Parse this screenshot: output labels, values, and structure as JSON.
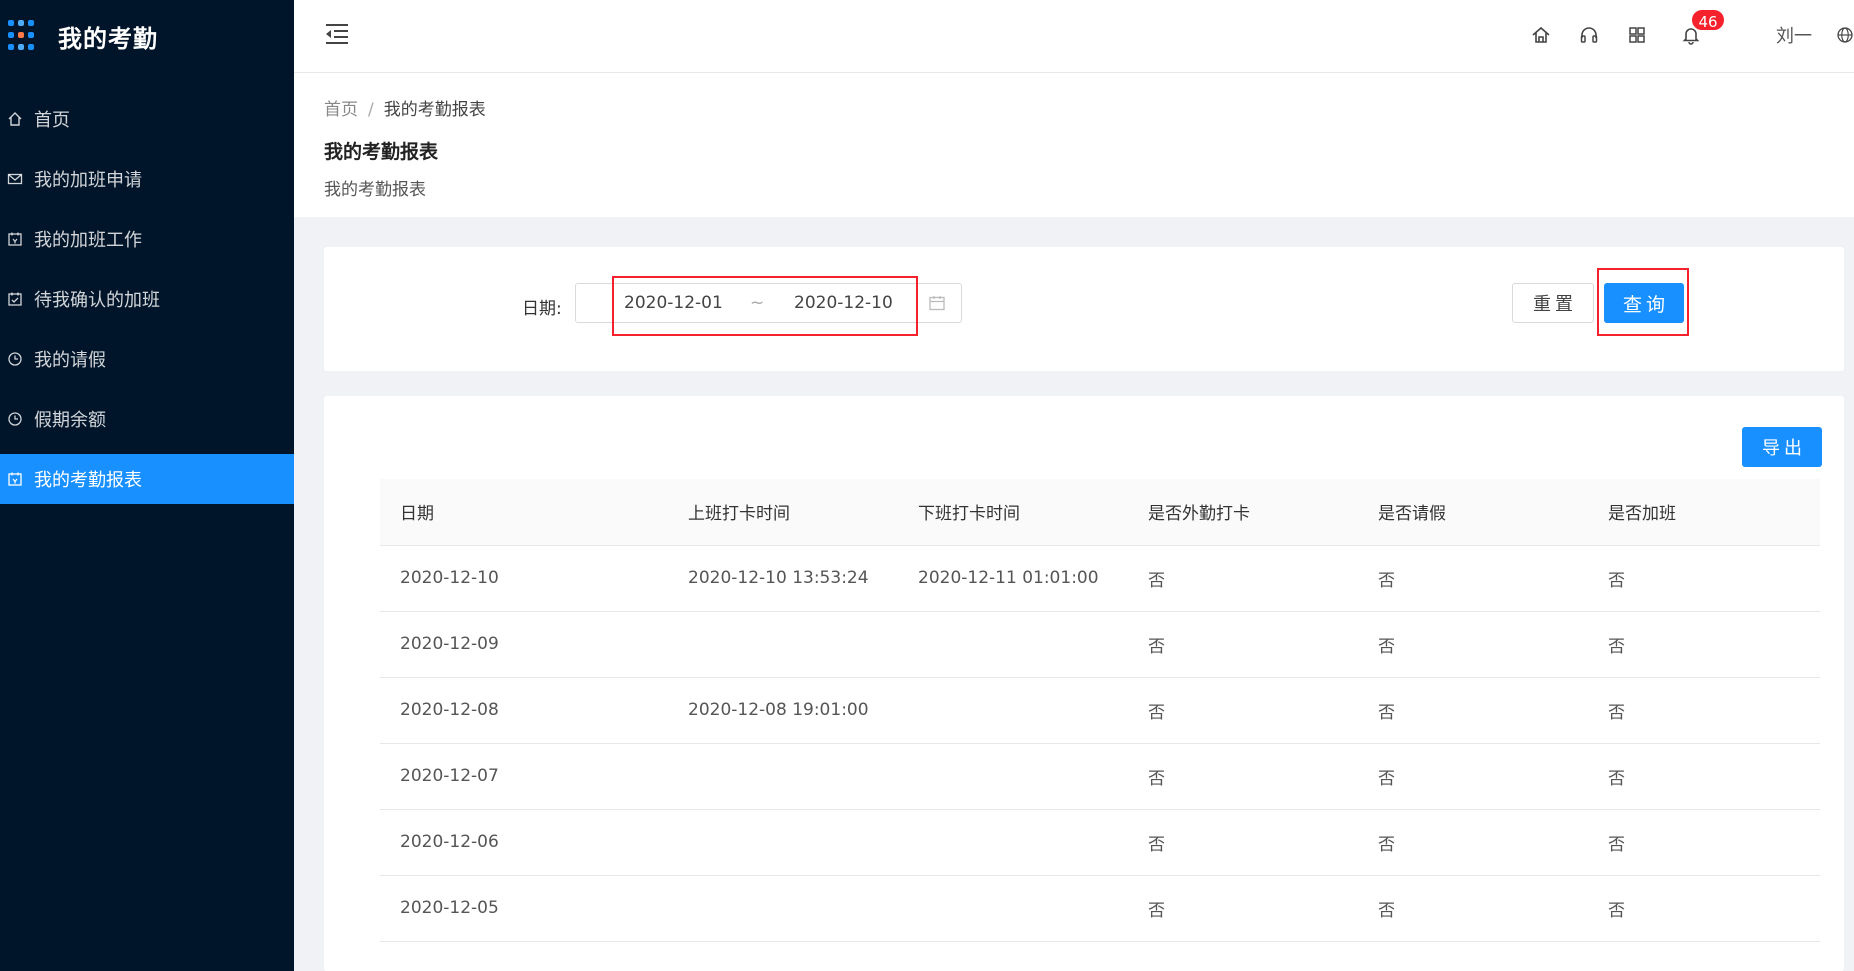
{
  "app": {
    "title": "我的考勤"
  },
  "sidebar": {
    "items": [
      {
        "label": "首页",
        "icon": "home-icon"
      },
      {
        "label": "我的加班申请",
        "icon": "mail-icon"
      },
      {
        "label": "我的加班工作",
        "icon": "calendar-icon"
      },
      {
        "label": "待我确认的加班",
        "icon": "check-icon"
      },
      {
        "label": "我的请假",
        "icon": "clock-icon"
      },
      {
        "label": "假期余额",
        "icon": "clock-icon"
      },
      {
        "label": "我的考勤报表",
        "icon": "calendar-icon",
        "active": true
      }
    ]
  },
  "header": {
    "icons": [
      "home-icon",
      "headset-icon",
      "apps-icon",
      "bell-icon",
      "globe-icon"
    ],
    "notification_count": "46",
    "username": "刘一"
  },
  "breadcrumb": {
    "home": "首页",
    "separator": "/",
    "current": "我的考勤报表"
  },
  "page": {
    "title": "我的考勤报表",
    "description": "我的考勤报表"
  },
  "search": {
    "date_label": "日期:",
    "start_date": "2020-12-01",
    "range_separator": "~",
    "end_date": "2020-12-10",
    "reset_label": "重置",
    "query_label": "查询"
  },
  "table": {
    "export_label": "导出",
    "columns": [
      "日期",
      "上班打卡时间",
      "下班打卡时间",
      "是否外勤打卡",
      "是否请假",
      "是否加班"
    ],
    "rows": [
      [
        "2020-12-10",
        "2020-12-10 13:53:24",
        "2020-12-11 01:01:00",
        "否",
        "否",
        "否"
      ],
      [
        "2020-12-09",
        "",
        "",
        "否",
        "否",
        "否"
      ],
      [
        "2020-12-08",
        "2020-12-08 19:01:00",
        "",
        "否",
        "否",
        "否"
      ],
      [
        "2020-12-07",
        "",
        "",
        "否",
        "否",
        "否"
      ],
      [
        "2020-12-06",
        "",
        "",
        "否",
        "否",
        "否"
      ],
      [
        "2020-12-05",
        "",
        "",
        "否",
        "否",
        "否"
      ]
    ]
  },
  "colors": {
    "sidebar_bg": "#001529",
    "primary": "#1890ff",
    "highlight_red": "#f5222d"
  }
}
